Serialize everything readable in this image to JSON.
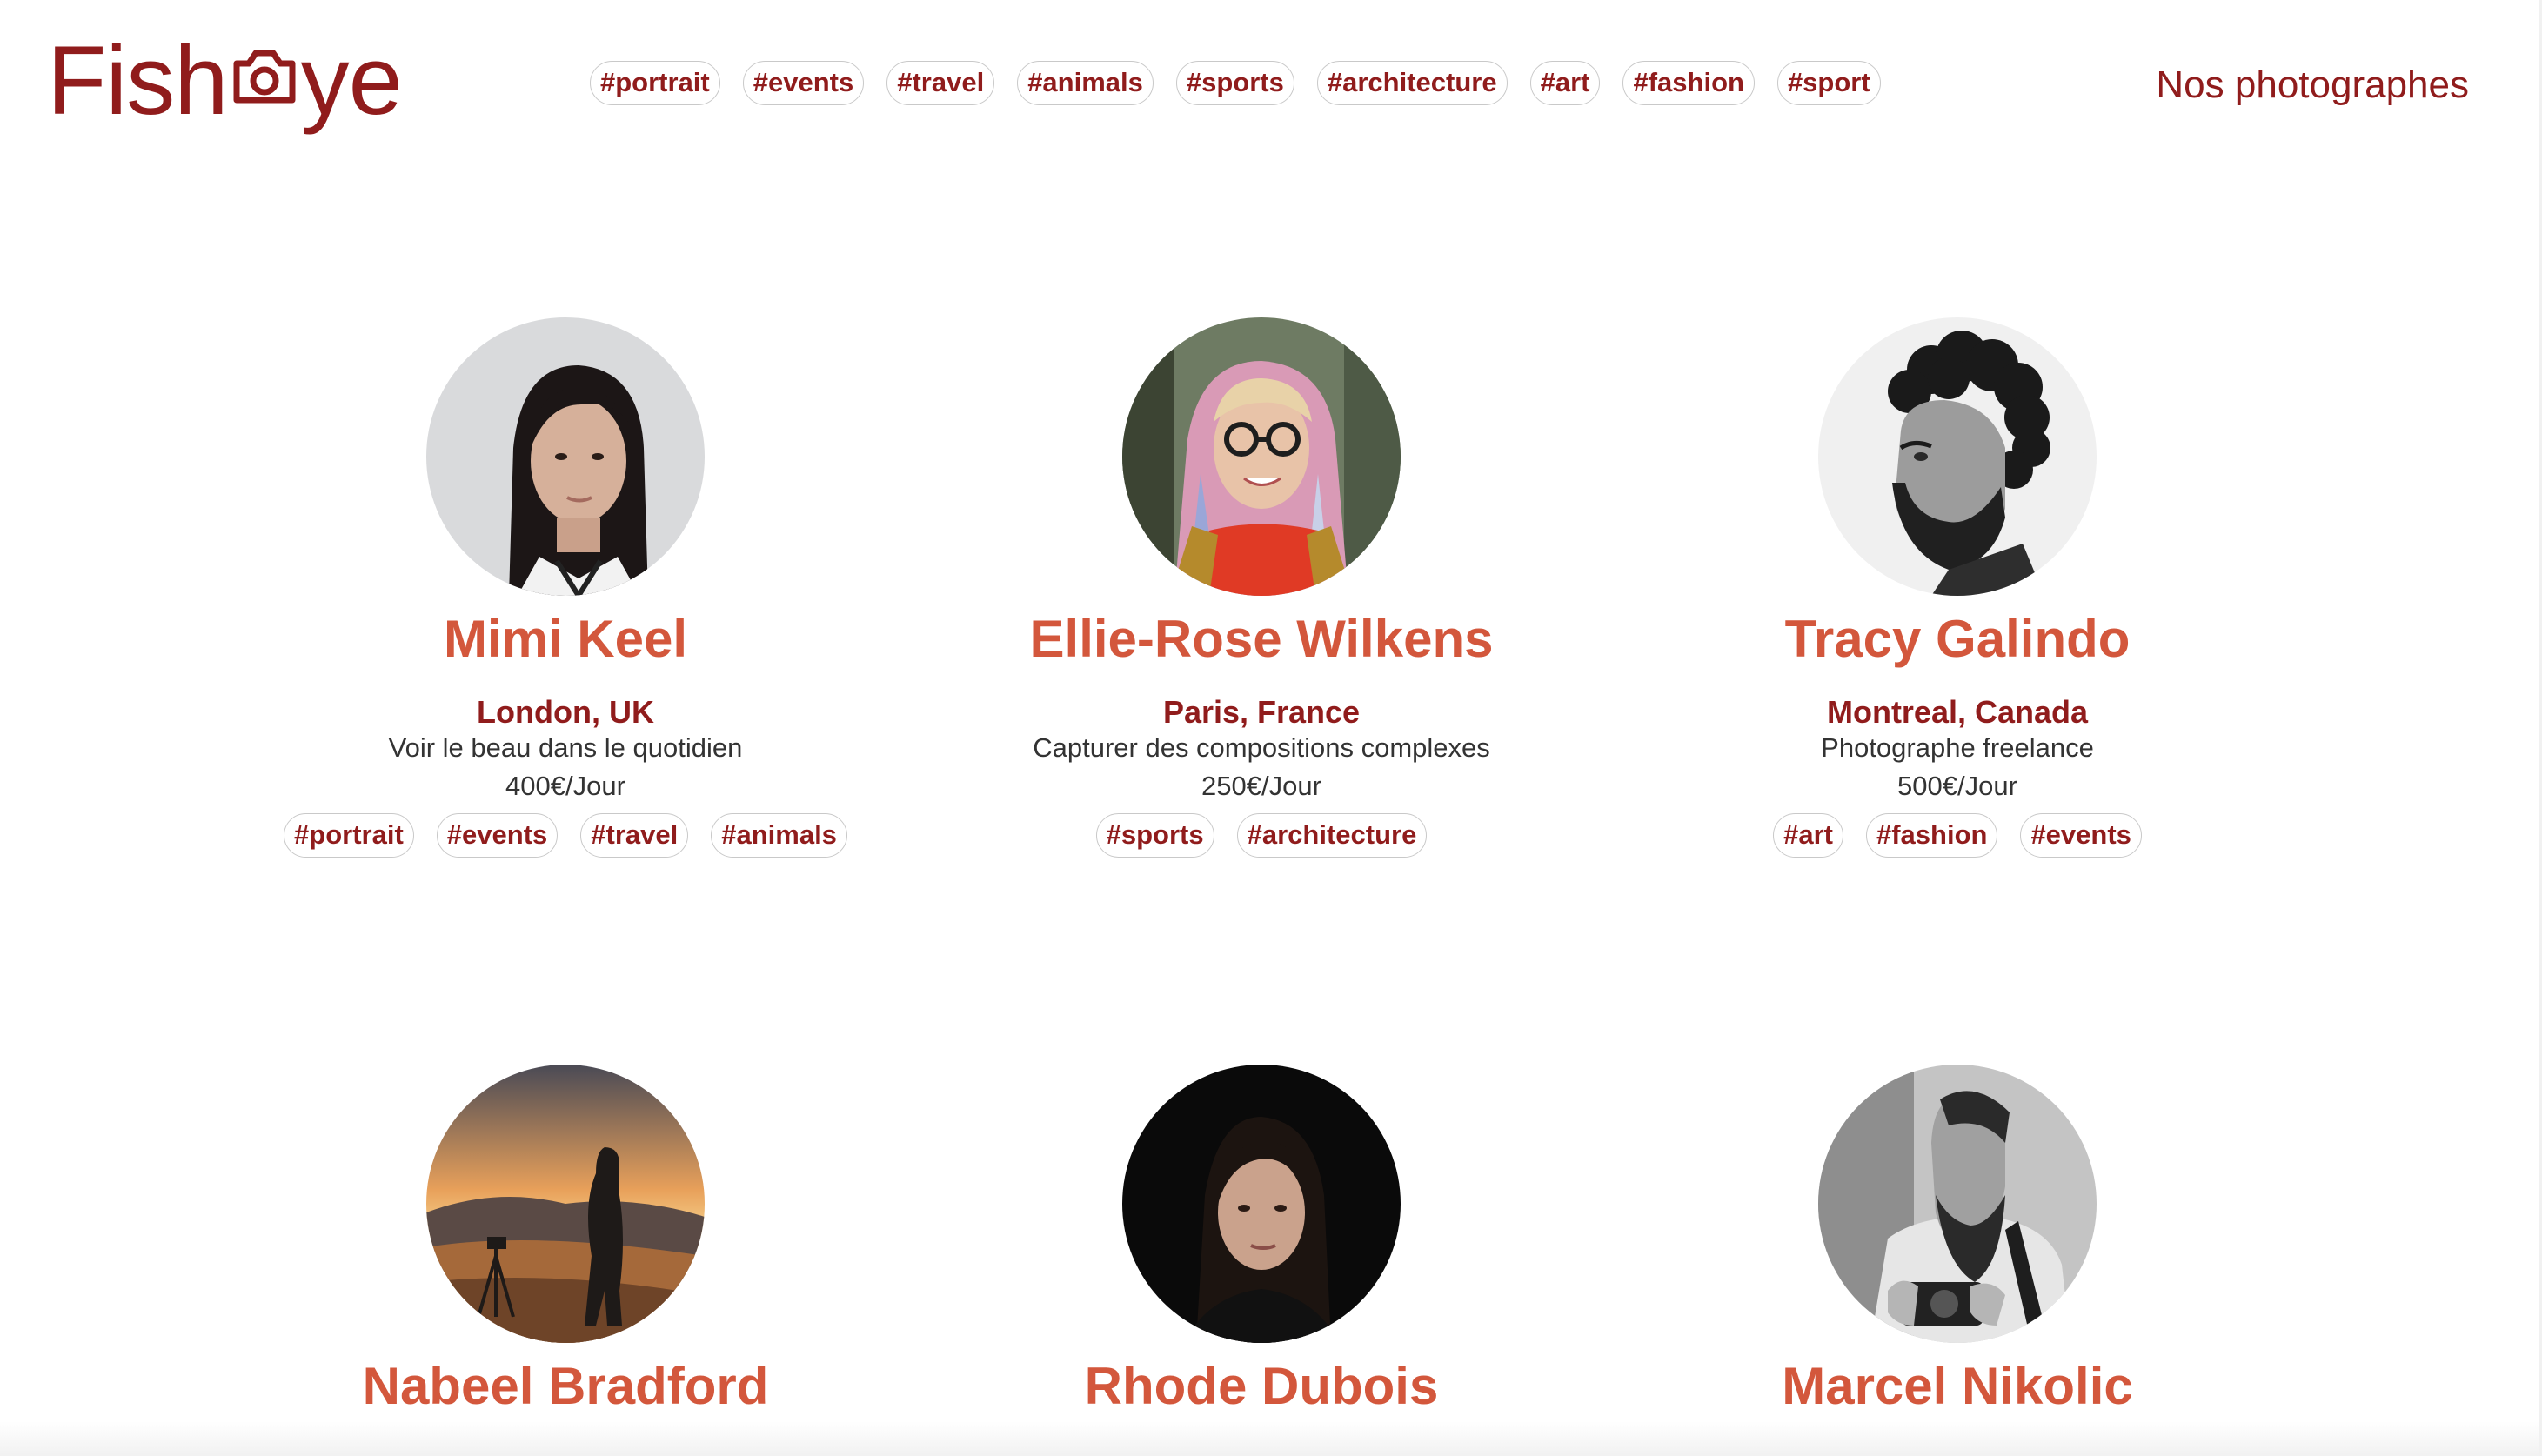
{
  "header": {
    "logo_left": "Fish",
    "logo_right": "ye",
    "logo_icon": "camera-icon",
    "link_label": "Nos photographes",
    "nav_tags": [
      "#portrait",
      "#events",
      "#travel",
      "#animals",
      "#sports",
      "#architecture",
      "#art",
      "#fashion",
      "#sport"
    ]
  },
  "colors": {
    "brand": "#901c1c",
    "name_accent": "#d3573c",
    "text": "#333333",
    "tag_border": "#c9c9c9"
  },
  "photographers": [
    {
      "name": "Mimi Keel",
      "location": "London, UK",
      "tagline": "Voir le beau dans le quotidien",
      "price": "400€/Jour",
      "tags": [
        "#portrait",
        "#events",
        "#travel",
        "#animals"
      ]
    },
    {
      "name": "Ellie-Rose Wilkens",
      "location": "Paris, France",
      "tagline": "Capturer des compositions complexes",
      "price": "250€/Jour",
      "tags": [
        "#sports",
        "#architecture"
      ]
    },
    {
      "name": "Tracy Galindo",
      "location": "Montreal, Canada",
      "tagline": "Photographe freelance",
      "price": "500€/Jour",
      "tags": [
        "#art",
        "#fashion",
        "#events"
      ]
    },
    {
      "name": "Nabeel Bradford"
    },
    {
      "name": "Rhode Dubois"
    },
    {
      "name": "Marcel Nikolic"
    }
  ]
}
